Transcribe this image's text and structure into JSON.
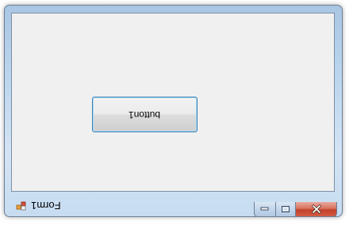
{
  "window": {
    "title": "Form1",
    "caption_buttons": {
      "minimize_icon": "minimize-icon",
      "maximize_icon": "maximize-icon",
      "close_icon": "close-icon"
    }
  },
  "form": {
    "button1_label": "button1"
  },
  "colors": {
    "client_background": "#f0f0f0",
    "frame": "#bcd6ee",
    "close_button": "#c2412b"
  }
}
